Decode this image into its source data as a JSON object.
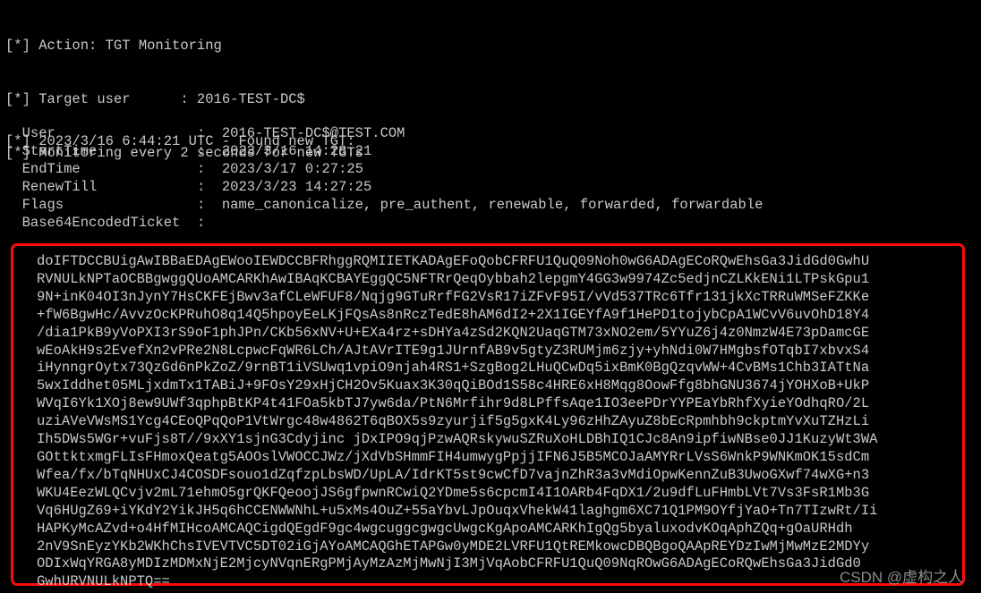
{
  "terminal": {
    "background_color": "#000000",
    "text_color": "#c9c9c9",
    "highlight_border_color": "#ff0a0a"
  },
  "header": {
    "lines": [
      "[*] Action: TGT Monitoring",
      "[*] Target user      : 2016-TEST-DC$",
      "[*] Monitoring every 2 seconds for new TGTs"
    ],
    "action_label": "Action:",
    "action_value": "TGT Monitoring",
    "target_user_label": "Target user",
    "target_user_value": "2016-TEST-DC$",
    "monitoring_text": "Monitoring every 2 seconds for new TGTs",
    "interval_seconds": "2"
  },
  "event": {
    "line": "[*] 2023/3/16 6:44:21 UTC - Found new TGT:",
    "timestamp": "2023/3/16 6:44:21",
    "timezone": "UTC",
    "message": "Found new TGT:"
  },
  "ticket_fields": [
    {
      "label": "User",
      "separator": ":",
      "value": "2016-TEST-DC$@TEST.COM"
    },
    {
      "label": "StartTime",
      "separator": ":",
      "value": "2023/3/16 14:28:21"
    },
    {
      "label": "EndTime",
      "separator": ":",
      "value": "2023/3/17 0:27:25"
    },
    {
      "label": "RenewTill",
      "separator": ":",
      "value": "2023/3/23 14:27:25"
    },
    {
      "label": "Flags",
      "separator": ":",
      "value": "name_canonicalize, pre_authent, renewable, forwarded, forwardable"
    },
    {
      "label": "Base64EncodedTicket",
      "separator": ":",
      "value": ""
    }
  ],
  "base64_ticket": {
    "lines": [
      "doIFTDCCBUigAwIBBaEDAgEWooIEWDCCBFRhggRQMIIETKADAgEFoQobCFRFU1QuQ09Noh0wG6ADAgECoRQwEhsGa3JidGd0GwhU",
      "RVNULkNPTaOCBBgwggQUoAMCARKhAwIBAqKCBAYEggQC5NFTRrQeqOybbah2lepgmY4GG3w9974Zc5edjnCZLKkENi1LTPskGpu1",
      "9N+inK04OI3nJynY7HsCKFEjBwv3afCLeWFUF8/Nqjg9GTuRrfFG2VsR17iZFvF95I/vVd537TRc6Tfr131jkXcTRRuWMSeFZKKe",
      "+fW6BgwHc/AvvzOcKPRuhO8q14Q5hpoyEeLKjFQsAs8nRczTedE8hAM6dI2+2X1IGEYfA9f1HePD1tojybCpA1WCvV6uvOhD18Y4",
      "/dia1PkB9yVoPXI3rS9oF1phJPn/CKb56xNV+U+EXa4rz+sDHYa4zSd2KQN2UaqGTM73xNO2em/5YYuZ6j4z0NmzW4E73pDamcGE",
      "wEoAkH9s2EvefXn2vPRe2N8LcpwcFqWR6LCh/AJtAVrITE9g1JUrnfAB9v5gtyZ3RUMjm6zjy+yhNdi0W7HMgbsfOTqbI7xbvxS4",
      "iHynngrOytx73QzGd6nPkZoZ/9rnBT1iVSUwq1vpiO9njah4RS1+SzgBog2LHuQCwDq5ixBmK0BgQzqvWW+4CvBMs1Chb3IATtNa",
      "5wxIddhet05MLjxdmTx1TABiJ+9FOsY29xHjCH2Ov5Kuax3K30qQiBOd1S58c4HRE6xH8Mqg8OowFfg8bhGNU3674jYOHXoB+UkP",
      "WVqI6Yk1XOj8ew9UWf3qphpBtKP4t41FOa5kbTJ7yw6da/PtN6Mrfihr9d8LPffsAqe1IO3eePDrYYPEaYbRhfXyieYOdhqRO/2L",
      "uziAVeVWsMS1Ycg4CEoQPqQoP1VtWrgc48w4862T6qBOX5s9zyurjif5g5gxK4Ly96zHhZAyuZ8bEcRpmhbh9ckptmYvXuTZHzLi",
      "Ih5DWs5WGr+vuFjs8T//9xXY1sjnG3Cdyjinc jDxIPO9qjPzwAQRskywuSZRuXoHLDBhIQ1CJc8An9ipfiwNBse0JJ1KuzyWt3WA",
      "GOttktxmgFLIsFHmoxQeatg5AOOslVWOCCJWz/jXdVbSHmmFIH4umwygPpjjIFN6J5B5MCOJaAMYRrLVsS6WnkP9WNKmOK15sdCm",
      "Wfea/fx/bTqNHUxCJ4COSDFsouo1dZqfzpLbsWD/UpLA/IdrKT5st9cwCfD7vajnZhR3a3vMdiOpwKennZuB3UwoGXwf74wXG+n3",
      "WKU4EezWLQCvjv2mL71ehmO5grQKFQeoojJS6gfpwnRCwiQ2YDme5s6cpcmI4I1OARb4FqDX1/2u9dfLuFHmbLVt7Vs3FsR1Mb3G",
      "Vq6HUgZ69+iYKdY2YikJH5q6hCCENWWNhL+u5xMs4OuZ+55aYbvLJpOuqxVhekW41laghgm6XC71Q1PM9OYfjYaO+Tn7TIzwRt/Ii",
      "HAPKyMcAZvd+o4HfMIHcoAMCAQCigdQEgdF9gc4wgcuggcgwgcUwgcKgApoAMCARKhIgQg5byaluxodvKOqAphZQq+gOaURHdh",
      "2nV9SnEyzYKb2WKhChsIVEVTVC5DT02iGjAYoAMCAQGhETAPGw0yMDE2LVRFU1QtREMkowcDBQBgoQAApREYDzIwMjMwMzE2MDYy",
      "ODIxWqYRGA8yMDIzMDMxNjE2MjcyNVqnERgPMjAyMzAzMjMwNjI3MjVqAobCFRFU1QuQ09NqROwG6ADAgECoRQwEhsGa3JidGd0",
      "GwhURVNULkNPTQ=="
    ]
  },
  "watermark": {
    "text": "CSDN @虚构之人"
  }
}
